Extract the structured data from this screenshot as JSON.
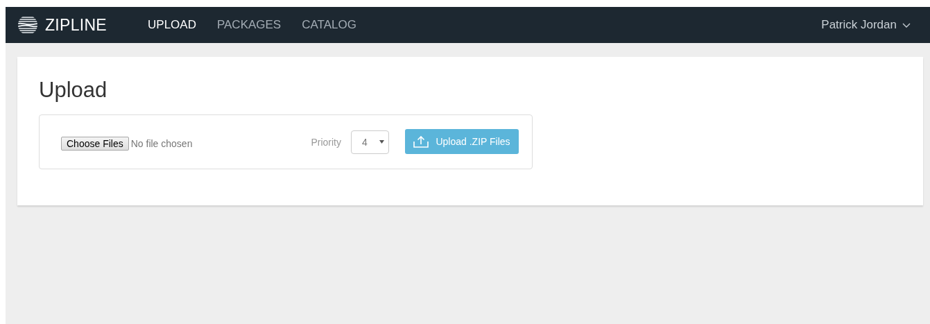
{
  "brand": "ZIPLINE",
  "nav": [
    {
      "label": "UPLOAD",
      "selected": true
    },
    {
      "label": "PACKAGES",
      "selected": false
    },
    {
      "label": "CATALOG",
      "selected": false
    }
  ],
  "user": {
    "name": "Patrick Jordan"
  },
  "page_title": "Upload",
  "file_input": {
    "button": "Choose Files",
    "status": "No file chosen"
  },
  "priority": {
    "label": "Priority",
    "value": "4"
  },
  "upload_button": "Upload .ZIP Files"
}
